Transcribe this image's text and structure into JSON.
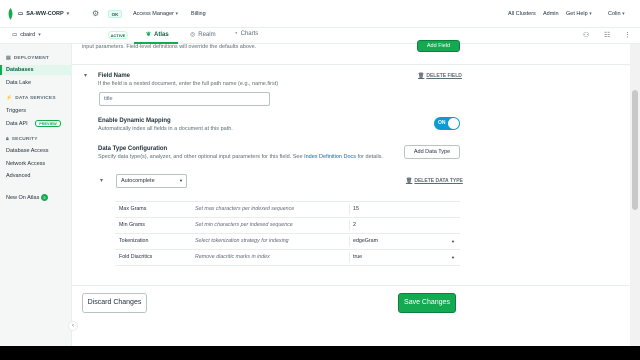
{
  "topbar": {
    "org_name": "SA-WW-CORP",
    "status_badge": "OK",
    "nav": [
      "Access Manager",
      "Billing"
    ],
    "right": [
      "All Clusters",
      "Admin",
      "Get Help",
      "Colin"
    ]
  },
  "secbar": {
    "project": "cbaird",
    "project_badge": "ACTIVE",
    "tabs": [
      "Atlas",
      "Realm",
      "Charts"
    ]
  },
  "sidebar": {
    "deployment_header": "DEPLOYMENT",
    "deployment_items": [
      "Databases",
      "Data Lake"
    ],
    "data_services_header": "DATA SERVICES",
    "data_services_items": [
      "Triggers",
      "Data API"
    ],
    "preview_badge": "PREVIEW",
    "security_header": "SECURITY",
    "security_items": [
      "Database Access",
      "Network Access",
      "Advanced"
    ],
    "new_on_atlas": "New On Atlas",
    "new_count": "5"
  },
  "main": {
    "intro_text": "input parameters. Field-level definitions will override the defaults above.",
    "add_field_button": "Add Field",
    "field_name_label": "Field Name",
    "field_name_help": "If the field is a nested document, enter the full path name (e.g., name.first)",
    "field_name_value": "title",
    "delete_field": "DELETE FIELD",
    "dynamic_mapping_label": "Enable Dynamic Mapping",
    "dynamic_mapping_help": "Automatically index all fields in a document at this path.",
    "toggle_state": "ON",
    "data_type_config_label": "Data Type Configuration",
    "data_type_config_help_pre": "Specify data type(s), analyzer, and other optional input parameters for this field. See ",
    "data_type_config_link": "Index Definition Docs",
    "data_type_config_help_post": " for details.",
    "add_data_type_button": "Add Data Type",
    "data_type_selected": "Autocomplete",
    "delete_data_type": "DELETE DATA TYPE",
    "table": [
      {
        "name": "Max Grams",
        "description": "Set max characters per indexed sequence",
        "value": "15",
        "dropdown": false
      },
      {
        "name": "Min Grams",
        "description": "Set min characters per indexed sequence",
        "value": "2",
        "dropdown": false
      },
      {
        "name": "Tokenization",
        "description": "Select tokenization strategy for indexing",
        "value": "edgeGram",
        "dropdown": true
      },
      {
        "name": "Fold Diacritics",
        "description": "Remove diacritic marks in index",
        "value": "true",
        "dropdown": true
      }
    ],
    "discard_button": "Discard Changes",
    "save_button": "Save Changes"
  },
  "colors": {
    "brand_green": "#13aa52",
    "toggle_blue": "#0d9bd5",
    "link_blue": "#006cbc",
    "active_bg": "#e1f7ee"
  },
  "icons": [
    "mongodb-leaf-icon",
    "gear-icon",
    "folder-icon",
    "leaf-icon",
    "realm-icon",
    "charts-icon",
    "invite-user-icon",
    "activity-feed-icon",
    "project-settings-icon",
    "database-icon",
    "lightning-icon",
    "lock-icon",
    "trash-icon",
    "chevron-down-icon",
    "chevron-left-icon"
  ]
}
